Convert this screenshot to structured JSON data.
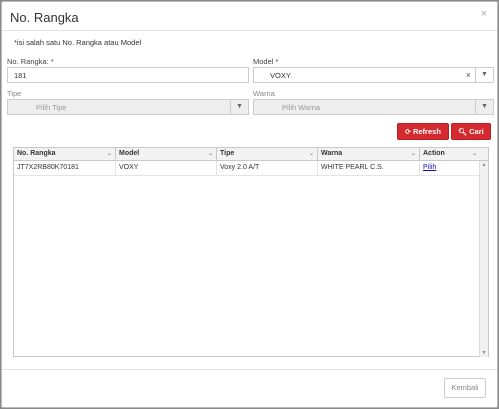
{
  "modal": {
    "title": "No. Rangka",
    "close": "×"
  },
  "note": "*isi salah satu No. Rangka atau Model",
  "form": {
    "no_rangka_label": "No. Rangka: *",
    "no_rangka_value": "181",
    "model_label": "Model *",
    "model_value": "VOXY",
    "model_clear": "×",
    "tipe_label": "Tipe",
    "tipe_placeholder": "Pilih Tipe",
    "warna_label": "Warna",
    "warna_placeholder": "Pilih Warna"
  },
  "buttons": {
    "refresh": "Refresh",
    "cari": "Cari",
    "kembali": "Kembali"
  },
  "icons": {
    "refresh": "refresh-icon",
    "search": "search-icon",
    "dropdown": "chevron-down-icon"
  },
  "table": {
    "headers": [
      "No. Rangka",
      "Model",
      "Tipe",
      "Warna",
      "Action"
    ],
    "rows": [
      [
        "JT7X2RB80K70181",
        "VOXY",
        "Voxy 2.0 A/T",
        "WHITE PEARL C.S.",
        "Pilih"
      ]
    ]
  }
}
